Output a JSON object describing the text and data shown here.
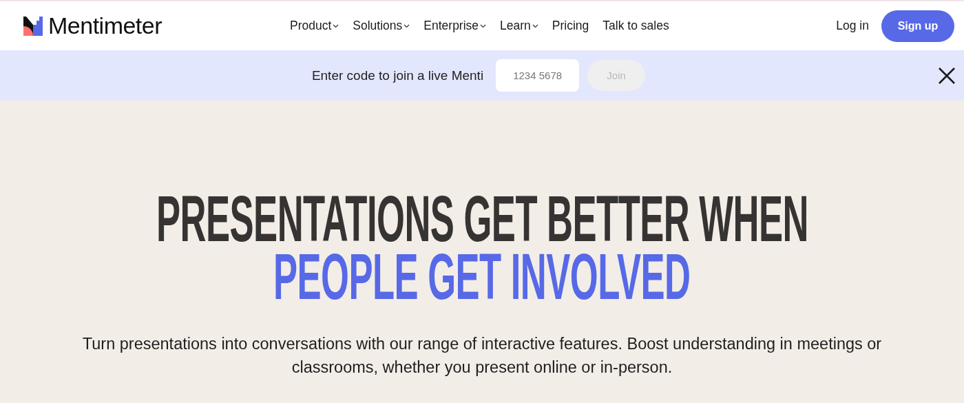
{
  "header": {
    "brand": "Mentimeter",
    "nav": [
      {
        "label": "Product",
        "kind": "menu"
      },
      {
        "label": "Solutions",
        "kind": "menu"
      },
      {
        "label": "Enterprise",
        "kind": "menu"
      },
      {
        "label": "Learn",
        "kind": "menu"
      },
      {
        "label": "Pricing",
        "kind": "link"
      },
      {
        "label": "Talk to sales",
        "kind": "link"
      }
    ],
    "login": "Log in",
    "signup": "Sign up"
  },
  "join_bar": {
    "prompt": "Enter code to join a live Menti",
    "placeholder": "1234 5678",
    "button": "Join",
    "disabled": true
  },
  "hero": {
    "headline_lines": [
      {
        "text": "PRESENTATIONS GET BETTER WHEN",
        "kind": "dark"
      },
      {
        "text": "PEOPLE GET INVOLVED",
        "kind": "accent"
      }
    ],
    "description": "Turn presentations into conversations with our range of interactive features. Boost understanding in meetings or classrooms, whether you present online or in-person."
  }
}
